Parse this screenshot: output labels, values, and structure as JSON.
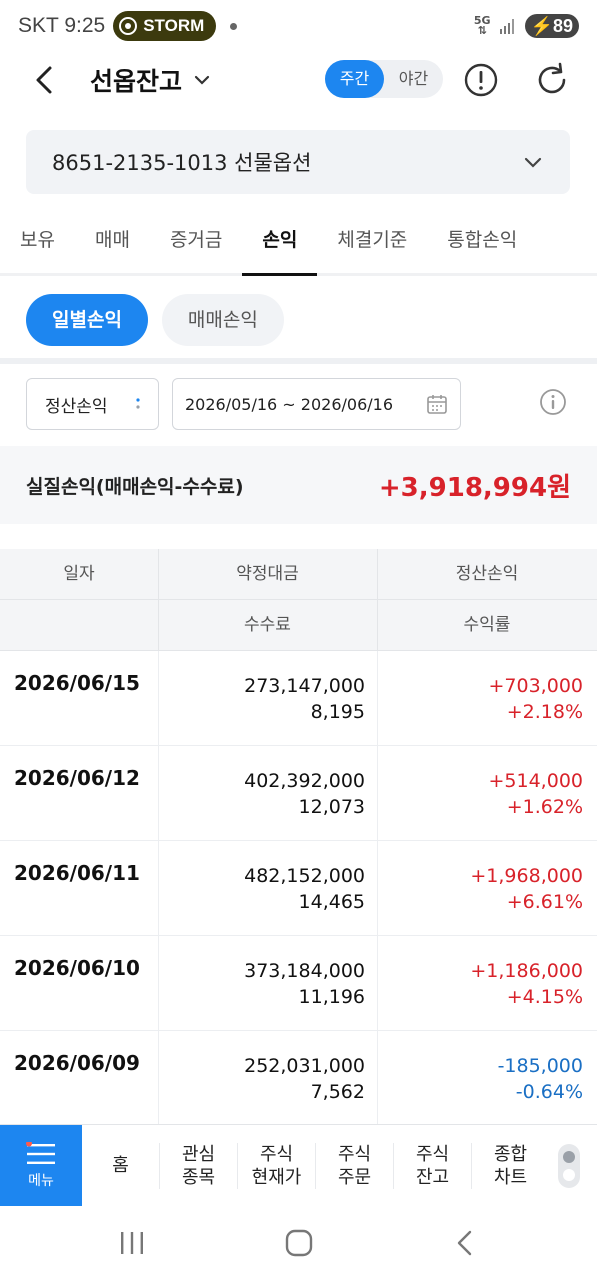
{
  "status_bar": {
    "carrier": "SKT",
    "time": "9:25",
    "app_badge": "STORM",
    "network": "5G",
    "battery": "89"
  },
  "header": {
    "title": "선옵잔고",
    "seg_on": "주간",
    "seg_off": "야간"
  },
  "account": {
    "label": "8651-2135-1013 선물옵션"
  },
  "tabs": [
    {
      "label": "보유",
      "active": false
    },
    {
      "label": "매매",
      "active": false
    },
    {
      "label": "증거금",
      "active": false
    },
    {
      "label": "손익",
      "active": true
    },
    {
      "label": "체결기준",
      "active": false
    },
    {
      "label": "통합손익",
      "active": false
    }
  ],
  "sub_tabs": {
    "daily": "일별손익",
    "trade": "매매손익"
  },
  "filter": {
    "type": "정산손익",
    "date_range": "2026/05/16 ~ 2026/06/16"
  },
  "summary": {
    "label": "실질손익(매매손익-수수료)",
    "value": "+3,918,994원"
  },
  "table": {
    "headers": {
      "date": "일자",
      "amount": "약정대금",
      "pl": "정산손익",
      "fee": "수수료",
      "rate": "수익률"
    },
    "rows": [
      {
        "date": "2026/06/15",
        "amount": "273,147,000",
        "fee": "8,195",
        "pl": "+703,000",
        "rate": "+2.18%",
        "sign": "pos"
      },
      {
        "date": "2026/06/12",
        "amount": "402,392,000",
        "fee": "12,073",
        "pl": "+514,000",
        "rate": "+1.62%",
        "sign": "pos"
      },
      {
        "date": "2026/06/11",
        "amount": "482,152,000",
        "fee": "14,465",
        "pl": "+1,968,000",
        "rate": "+6.61%",
        "sign": "pos"
      },
      {
        "date": "2026/06/10",
        "amount": "373,184,000",
        "fee": "11,196",
        "pl": "+1,186,000",
        "rate": "+4.15%",
        "sign": "pos"
      },
      {
        "date": "2026/06/09",
        "amount": "252,031,000",
        "fee": "7,562",
        "pl": "-185,000",
        "rate": "-0.64%",
        "sign": "neg"
      }
    ]
  },
  "bottom_menu": {
    "menu_label": "메뉴",
    "items": [
      "홈",
      "관심\n종목",
      "주식\n현재가",
      "주식\n주문",
      "주식\n잔고",
      "종합\n차트"
    ]
  },
  "colors": {
    "accent": "#1d86f0",
    "positive": "#d8222a",
    "negative": "#1a6fc4"
  }
}
